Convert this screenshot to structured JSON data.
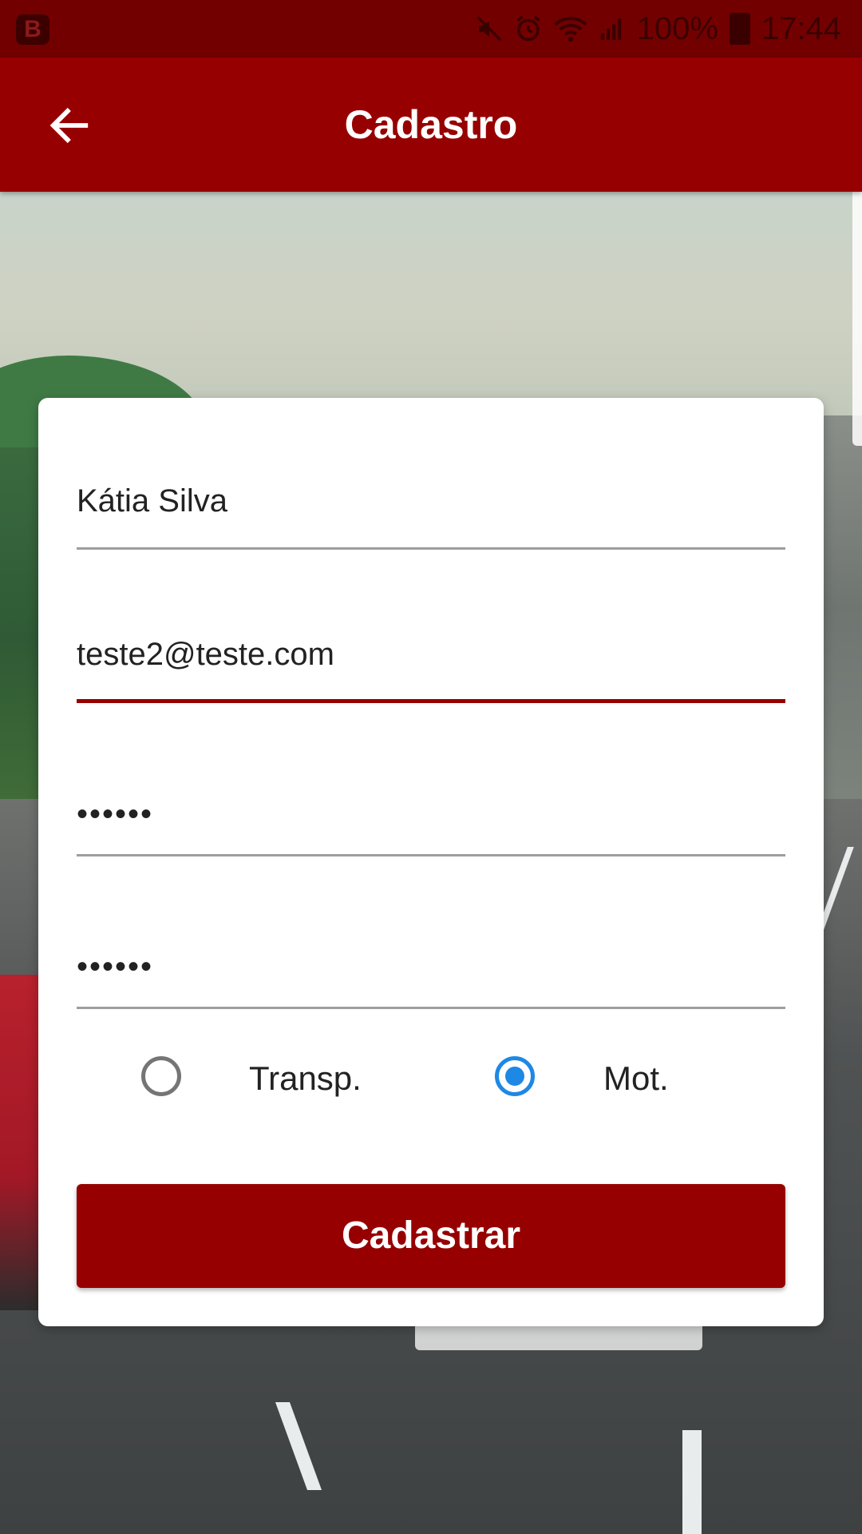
{
  "status_bar": {
    "app_badge": "B",
    "battery_level": "100%",
    "time": "17:44",
    "icons": [
      "mute-icon",
      "alarm-icon",
      "wifi-icon",
      "signal-icon",
      "battery-icon"
    ]
  },
  "app_bar": {
    "title": "Cadastro",
    "back_icon": "arrow-left-icon"
  },
  "form": {
    "name_value": "Kátia Silva",
    "email_value": "teste2@teste.com",
    "password_value": "••••••",
    "confirm_password_value": "••••••",
    "user_type": {
      "options": [
        {
          "label": "Transp.",
          "checked": false
        },
        {
          "label": "Mot.",
          "checked": true
        }
      ]
    },
    "submit_label": "Cadastrar"
  },
  "colors": {
    "status_bar": "#730000",
    "app_bar": "#970000",
    "accent": "#970000",
    "radio_checked": "#1e88e5",
    "card": "#ffffff"
  }
}
